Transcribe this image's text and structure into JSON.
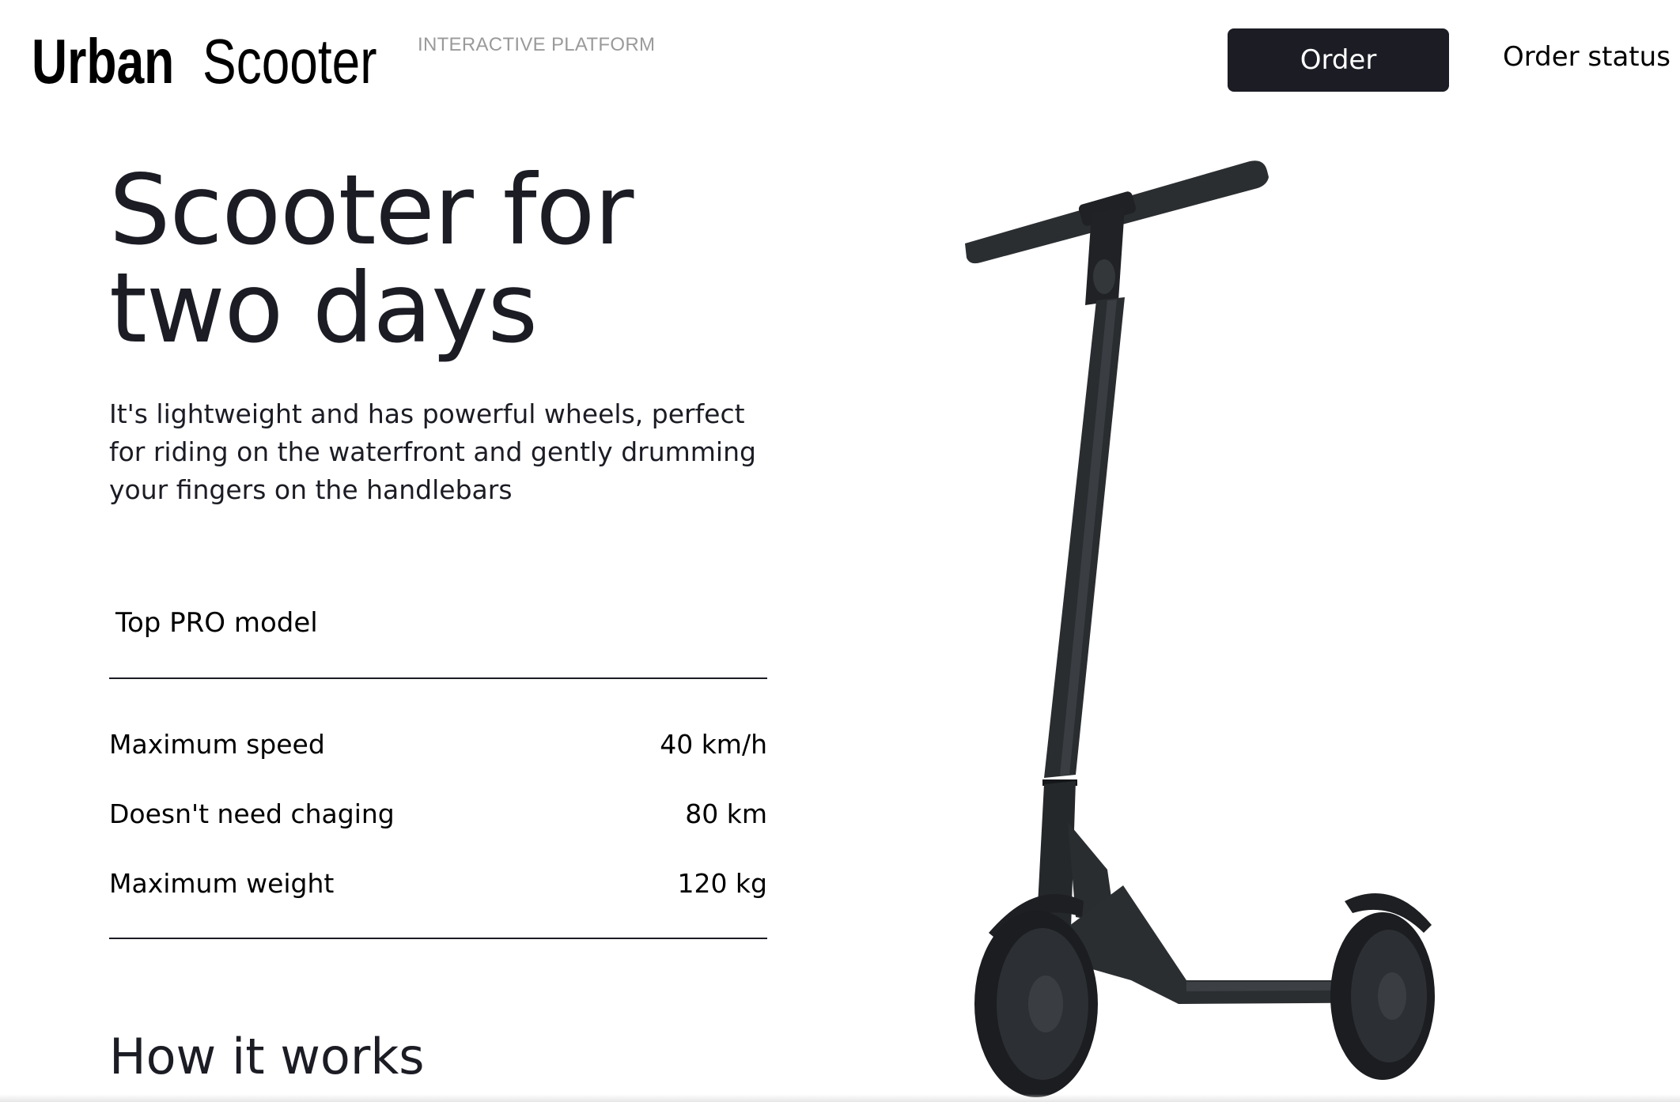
{
  "header": {
    "logo_bold": "Urban",
    "logo_light": "Scooter",
    "logo_tag": "INTERACTIVE PLATFORM",
    "order_label": "Order",
    "status_label": "Order status"
  },
  "hero": {
    "title_line1": "Scooter for",
    "title_line2": "two days",
    "description": "It's lightweight and has powerful wheels, perfect for riding on the waterfront and gently drumming your fingers on the handlebars"
  },
  "specs": {
    "model": "Top PRO model",
    "rows": [
      {
        "label": "Maximum speed",
        "value": "40 km/h"
      },
      {
        "label": "Doesn't need chaging",
        "value": "80 km"
      },
      {
        "label": "Maximum weight",
        "value": "120 kg"
      }
    ]
  },
  "how": {
    "title": "How it works"
  },
  "colors": {
    "text": "#1b1c24",
    "button_bg": "#1b1c24",
    "button_text": "#ffffff",
    "scooter": "#2a2d30"
  },
  "icons": {
    "product_image": "scooter-image"
  }
}
